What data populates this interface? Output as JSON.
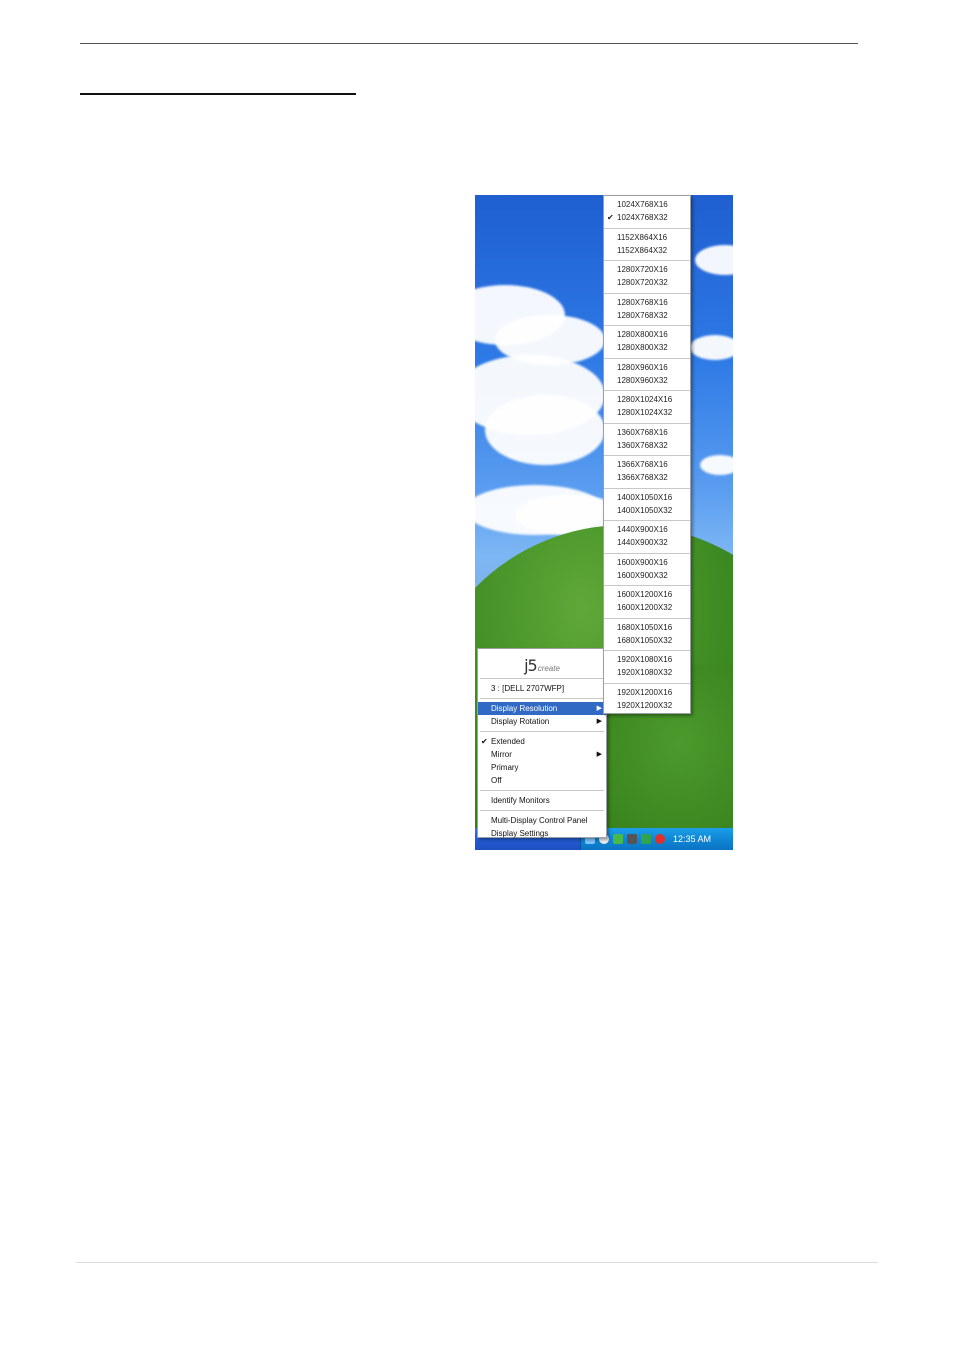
{
  "document": {
    "has_top_rule": true,
    "has_heading_underline": true
  },
  "desktop": {
    "taskbar": {
      "clock": "12:35 AM"
    }
  },
  "context_menu": {
    "logo": {
      "main": "j5",
      "sub": "create"
    },
    "monitor_label": "3 : [DELL 2707WFP]",
    "items": [
      {
        "label": "Display Resolution",
        "has_submenu": true,
        "highlighted": true
      },
      {
        "label": "Display Rotation",
        "has_submenu": true
      },
      {
        "label": "Extended",
        "checked": true
      },
      {
        "label": "Mirror",
        "has_submenu": true
      },
      {
        "label": "Primary"
      },
      {
        "label": "Off"
      },
      {
        "label": "Identify Monitors"
      },
      {
        "label": "Multi-Display Control Panel"
      },
      {
        "label": "Display Settings"
      }
    ]
  },
  "resolution_submenu": {
    "groups": [
      [
        "1024X768X16",
        "1024X768X32"
      ],
      [
        "1152X864X16",
        "1152X864X32"
      ],
      [
        "1280X720X16",
        "1280X720X32"
      ],
      [
        "1280X768X16",
        "1280X768X32"
      ],
      [
        "1280X800X16",
        "1280X800X32"
      ],
      [
        "1280X960X16",
        "1280X960X32"
      ],
      [
        "1280X1024X16",
        "1280X1024X32"
      ],
      [
        "1360X768X16",
        "1360X768X32"
      ],
      [
        "1366X768X16",
        "1366X768X32"
      ],
      [
        "1400X1050X16",
        "1400X1050X32"
      ],
      [
        "1440X900X16",
        "1440X900X32"
      ],
      [
        "1600X900X16",
        "1600X900X32"
      ],
      [
        "1600X1200X16",
        "1600X1200X32"
      ],
      [
        "1680X1050X16",
        "1680X1050X32"
      ],
      [
        "1920X1080X16",
        "1920X1080X32"
      ],
      [
        "1920X1200X16",
        "1920X1200X32"
      ]
    ],
    "checked": "1024X768X32"
  },
  "icons": {
    "check": "checkmark-icon",
    "submenu_arrow": "submenu-arrow-icon"
  }
}
